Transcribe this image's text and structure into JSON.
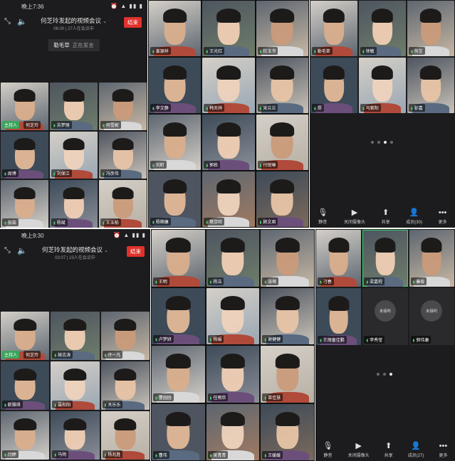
{
  "p1": {
    "time": "晚上7:36",
    "status_icons": "⏰ ▲ ▮▮ ▮",
    "title": "何芝玲发起的视频会议",
    "subtitle": "06:00 | 27人在会议中",
    "end_label": "结束",
    "speaking_name": "勒毛草",
    "speaking_status": "正在发言",
    "tiles": [
      {
        "name": "何芝玲",
        "host": "主持人"
      },
      {
        "name": "苏梦丽"
      },
      {
        "name": "何雪妮"
      },
      {
        "name": "周博"
      },
      {
        "name": "刘保江"
      },
      {
        "name": "冯彦伟"
      },
      {
        "name": "张茹"
      },
      {
        "name": "杨斌"
      },
      {
        "name": "王玉柏"
      }
    ]
  },
  "p2": {
    "tiles": [
      {
        "name": "姜源祥"
      },
      {
        "name": "王光红"
      },
      {
        "name": "杜玉书"
      },
      {
        "name": "李文静"
      },
      {
        "name": "韩天祥"
      },
      {
        "name": "宋兰兰"
      },
      {
        "name": "刘昕"
      },
      {
        "name": "郭栋"
      },
      {
        "name": "付锐琳"
      },
      {
        "name": "杨顺康"
      },
      {
        "name": "樊京旺"
      },
      {
        "name": "顾文君"
      }
    ]
  },
  "p3": {
    "tiles": [
      {
        "name": "勒毛草"
      },
      {
        "name": "徐敏"
      },
      {
        "name": "何芝"
      },
      {
        "name": "郑"
      },
      {
        "name": "马紫阳"
      },
      {
        "name": "彭嘉"
      }
    ],
    "bottom": [
      {
        "icon": "🎙",
        "label": "静音"
      },
      {
        "icon": "▶",
        "label": "关闭摄像头"
      },
      {
        "icon": "⬆",
        "label": "共享"
      },
      {
        "icon": "👤",
        "label": "成员(30)"
      },
      {
        "icon": "•••",
        "label": "更多"
      }
    ]
  },
  "p4": {
    "time": "晚上9:30",
    "status_icons": "⏰ ▲ ▮▮ ▮",
    "title": "何芝玲发起的视频会议",
    "subtitle": "03:07 | 23人在会议中",
    "end_label": "结束",
    "tiles": [
      {
        "name": "何芝玲",
        "host": "主持人"
      },
      {
        "name": "赫志涛"
      },
      {
        "name": "许一凡"
      },
      {
        "name": "靳雅琪"
      },
      {
        "name": "聂和阳"
      },
      {
        "name": "关乐乐"
      },
      {
        "name": "闫婷"
      },
      {
        "name": "马明"
      },
      {
        "name": "杨兆胜"
      }
    ]
  },
  "p5": {
    "tiles": [
      {
        "name": "王明"
      },
      {
        "name": "杨洁"
      },
      {
        "name": "张萌"
      },
      {
        "name": "卢梦妍"
      },
      {
        "name": "杨娟"
      },
      {
        "name": "谢健健"
      },
      {
        "name": "曹园园"
      },
      {
        "name": "任雨欣"
      },
      {
        "name": "苗佳慧"
      },
      {
        "name": "曹伟"
      },
      {
        "name": "吴青青"
      },
      {
        "name": "王媛媛"
      }
    ]
  },
  "p6": {
    "tiles": [
      {
        "name": "刁春"
      },
      {
        "name": "梁嘉程"
      },
      {
        "name": "秦俊"
      },
      {
        "name": "王丽童佳鹏"
      },
      {
        "name": "李秀莹",
        "placeholder": "未接听"
      },
      {
        "name": "郭伟康",
        "placeholder": "未接听"
      }
    ],
    "bottom": [
      {
        "icon": "🎙",
        "label": "静音"
      },
      {
        "icon": "▶",
        "label": "关闭摄像头"
      },
      {
        "icon": "⬆",
        "label": "共享"
      },
      {
        "icon": "👤",
        "label": "成员(27)"
      },
      {
        "icon": "•••",
        "label": "更多"
      }
    ]
  },
  "colors": {
    "accent_end": "#e0312b",
    "host_green": "#3ba55c",
    "mic_green": "#4fd16a",
    "panel_bg": "#1c1c1e"
  }
}
